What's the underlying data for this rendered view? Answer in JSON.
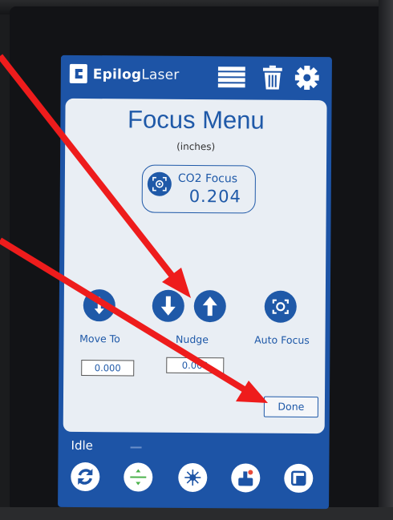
{
  "brand": {
    "bold": "Epilog",
    "light": "Laser"
  },
  "toolbar": {
    "icons": [
      "menu-list-icon",
      "trash-icon",
      "gear-icon"
    ]
  },
  "focus_menu": {
    "title": "Focus Menu",
    "units": "(inches)",
    "co2_focus": {
      "label": "CO2 Focus",
      "value": "0.204"
    },
    "move_to": {
      "label": "Move To",
      "value": "0.000"
    },
    "nudge": {
      "label": "Nudge",
      "value": "0.000"
    },
    "auto_focus": {
      "label": "Auto Focus"
    },
    "done_label": "Done"
  },
  "status_bar": {
    "state": "Idle",
    "buttons": [
      "refresh-icon",
      "focus-plane-icon",
      "laser-pointer-icon",
      "job-run-icon",
      "frame-icon"
    ]
  },
  "colors": {
    "accent": "#1f59a8",
    "screen": "#1d54a6",
    "card": "#e9eef4",
    "annotation_arrow": "#ee1c1c"
  }
}
